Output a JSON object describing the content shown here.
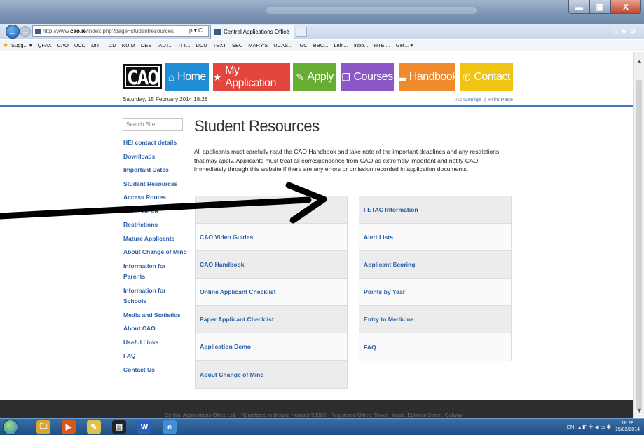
{
  "browser": {
    "url_prefix": "http://www.",
    "url_host": "cao.ie",
    "url_path": "/index.php?page=studentresources",
    "address_tools": "ρ ▾ C",
    "tab_title": "Central Applications Office",
    "tab_close": "×",
    "nav_right": "⌂★⚙",
    "favorites": [
      "Sugg... ▾",
      "QFAX",
      "CAO",
      "UCD",
      "DIT",
      "TCD",
      "NUIM",
      "DES",
      "IADT...",
      "ITT...",
      "DCU",
      "TEXT",
      "SEC",
      "MARY'S",
      "UCAS...",
      "IGC",
      "BBC...",
      "Lein...",
      "Inbo...",
      "RTÉ ...",
      "Get... ▾"
    ],
    "win_min": "▬",
    "win_max": "▣",
    "win_close": "X"
  },
  "site": {
    "logo_text": "CAO",
    "nav": [
      {
        "label": "Home",
        "icon": "⌂",
        "color": "#1f8ed6"
      },
      {
        "label": "My Application",
        "icon": "★",
        "color": "#e2463c"
      },
      {
        "label": "Apply",
        "icon": "✎",
        "color": "#68ad34"
      },
      {
        "label": "Courses",
        "icon": "❐",
        "color": "#8c57c6"
      },
      {
        "label": "Handbook",
        "icon": "▬",
        "color": "#ee8b2d"
      },
      {
        "label": "Contact",
        "icon": "✆",
        "color": "#f0c414"
      }
    ],
    "date": "Saturday, 15 February 2014 18:28",
    "lang_link": "As Gaeilge",
    "print_link": "Print Page",
    "lang_sep": "|",
    "search_placeholder": "Search Site...",
    "sidebar": [
      "HEI contact details",
      "Downloads",
      "Important Dates",
      "Student Resources",
      "Access Routes",
      "DARE HEAR",
      "Restrictions",
      "Mature Applicants",
      "About Change of Mind",
      "Information for Parents",
      "Information for Schools",
      "Media and Statistics",
      "About CAO",
      "Useful Links",
      "FAQ",
      "Contact Us"
    ],
    "page_title": "Student Resources",
    "intro": "All applicants must carefully read the CAO Handbook and take note of the important deadlines and any restrictions that may apply. Applicants must treat all correspondence from CAO as extremely important and notify CAO immediately through this website if there are any errors or omission recorded in application documents.",
    "left_column": [
      "",
      "CAO Video Guides",
      "CAO Handbook",
      "Online Applicant Checklist",
      "Paper Applicant Checklist",
      "Application Demo",
      "About Change of Mind"
    ],
    "right_column": [
      "FETAC Information",
      "Alert Lists",
      "Applicant Scoring",
      "Points by Year",
      "Entry to Medicine",
      "FAQ"
    ],
    "footer": "Central Applications Office Ltd. - Registered in Ireland Number 53983 - Registered Office: Tower House, Eglinton Street, Galway"
  },
  "taskbar": {
    "apps": [
      "🗀",
      "▶",
      "✎",
      "▤",
      "W",
      "e"
    ],
    "lang": "EN",
    "time": "18:28",
    "date": "15/02/2014"
  }
}
